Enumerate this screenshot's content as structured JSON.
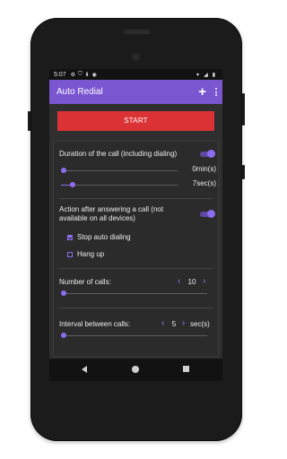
{
  "status_bar": {
    "time": "5:07",
    "icons": [
      "gear-icon",
      "shield-icon",
      "download-icon",
      "circle-icon"
    ],
    "right_icons": [
      "wifi-icon",
      "signal-icon",
      "battery-icon"
    ]
  },
  "app_bar": {
    "title": "Auto Redial",
    "add_icon": "+",
    "menu_icon": "more-vertical-icon"
  },
  "start_button": {
    "label": "START"
  },
  "duration": {
    "label": "Duration of the call (including dialing)",
    "enabled": true,
    "min_value": "0",
    "min_unit": "min(s)",
    "min_slider_fraction": 0.0,
    "sec_value": "7",
    "sec_unit": "sec(s)",
    "sec_slider_fraction": 0.08
  },
  "answer_action": {
    "label": "Action after answering a call (not available on all devices)",
    "enabled": true,
    "options": [
      {
        "label": "Stop auto dialing",
        "checked": true
      },
      {
        "label": "Hang up",
        "checked": false
      }
    ]
  },
  "number_of_calls": {
    "label": "Number of calls:",
    "value": "10",
    "slider_fraction": 0.0
  },
  "interval": {
    "label": "Interval between calls:",
    "value": "5",
    "unit": "sec(s)",
    "slider_fraction": 0.0
  },
  "colors": {
    "accent": "#8c6df0",
    "app_bar": "#7a56d1",
    "start_button": "#db3236",
    "background": "#2f2f2f"
  }
}
